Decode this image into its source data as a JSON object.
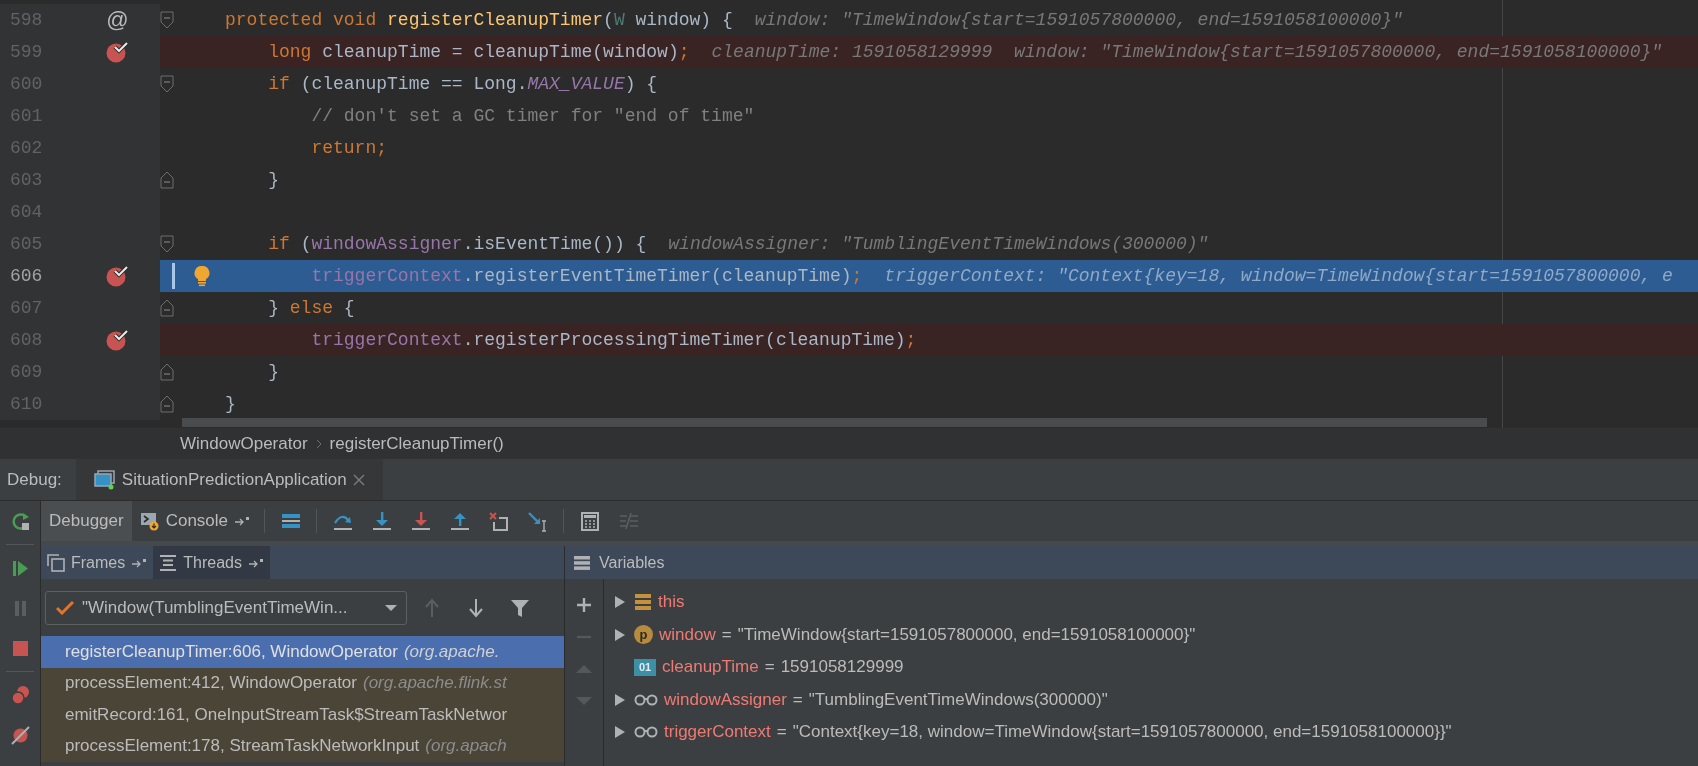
{
  "editor": {
    "lines": [
      {
        "number": "598",
        "gutter_mark": "@",
        "breakpoint": false,
        "current": false,
        "intention": false,
        "fold_start": true,
        "fold_end": false,
        "tokens": [
          {
            "text": "protected void ",
            "kind": "keyword"
          },
          {
            "text": "registerCleanupTimer",
            "kind": "method"
          },
          {
            "text": "(",
            "kind": "plain"
          },
          {
            "text": "W",
            "kind": "type"
          },
          {
            "text": " window) {",
            "kind": "plain"
          }
        ],
        "hint": "window: \"TimeWindow{start=1591057800000, end=1591058100000}\""
      },
      {
        "number": "599",
        "breakpoint": true,
        "current": false,
        "intention": false,
        "fold_start": false,
        "fold_end": false,
        "tokens": [
          {
            "text": "    long ",
            "kind": "keyword"
          },
          {
            "text": "cleanupTime = cleanupTime(window)",
            "kind": "plain"
          },
          {
            "text": ";",
            "kind": "keyword"
          }
        ],
        "hint": "cleanupTime: 1591058129999  window: \"TimeWindow{start=1591057800000, end=1591058100000}\""
      },
      {
        "number": "600",
        "breakpoint": false,
        "current": false,
        "intention": false,
        "fold_start": true,
        "fold_end": false,
        "tokens": [
          {
            "text": "    if ",
            "kind": "keyword"
          },
          {
            "text": "(cleanupTime == Long.",
            "kind": "plain"
          },
          {
            "text": "MAX_VALUE",
            "kind": "constant"
          },
          {
            "text": ") {",
            "kind": "plain"
          }
        ]
      },
      {
        "number": "601",
        "breakpoint": false,
        "current": false,
        "intention": false,
        "fold_start": false,
        "fold_end": false,
        "tokens": [
          {
            "text": "        // don't set a GC timer for \"end of time\"",
            "kind": "comment"
          }
        ]
      },
      {
        "number": "602",
        "breakpoint": false,
        "current": false,
        "intention": false,
        "fold_start": false,
        "fold_end": false,
        "tokens": [
          {
            "text": "        return;",
            "kind": "keyword"
          }
        ]
      },
      {
        "number": "603",
        "breakpoint": false,
        "current": false,
        "intention": false,
        "fold_start": false,
        "fold_end": true,
        "tokens": [
          {
            "text": "    }",
            "kind": "plain"
          }
        ]
      },
      {
        "number": "604",
        "breakpoint": false,
        "current": false,
        "intention": false,
        "fold_start": false,
        "fold_end": false
      },
      {
        "number": "605",
        "breakpoint": false,
        "current": false,
        "intention": false,
        "fold_start": true,
        "fold_end": false,
        "tokens": [
          {
            "text": "    if ",
            "kind": "keyword"
          },
          {
            "text": "(",
            "kind": "plain"
          },
          {
            "text": "windowAssigner",
            "kind": "field"
          },
          {
            "text": ".isEventTime()) {",
            "kind": "plain"
          }
        ],
        "hint": "windowAssigner: \"TumblingEventTimeWindows(300000)\""
      },
      {
        "number": "606",
        "breakpoint": true,
        "current": true,
        "intention": true,
        "fold_start": false,
        "fold_end": false,
        "tokens": [
          {
            "text": "        triggerContext",
            "kind": "field"
          },
          {
            "text": ".registerEventTimeTimer(cleanupTime)",
            "kind": "plain"
          },
          {
            "text": ";",
            "kind": "keyword"
          }
        ],
        "hint": "triggerContext: \"Context{key=18, window=TimeWindow{start=1591057800000, e"
      },
      {
        "number": "607",
        "breakpoint": false,
        "current": false,
        "intention": false,
        "fold_start": false,
        "fold_end": true,
        "tokens": [
          {
            "text": "    } ",
            "kind": "plain"
          },
          {
            "text": "else",
            "kind": "keyword"
          },
          {
            "text": " {",
            "kind": "plain"
          }
        ]
      },
      {
        "number": "608",
        "breakpoint": true,
        "current": false,
        "intention": false,
        "fold_start": false,
        "fold_end": false,
        "tokens": [
          {
            "text": "        triggerContext",
            "kind": "field"
          },
          {
            "text": ".registerProcessingTimeTimer(cleanupTime)",
            "kind": "plain"
          },
          {
            "text": ";",
            "kind": "keyword"
          }
        ]
      },
      {
        "number": "609",
        "breakpoint": false,
        "current": false,
        "intention": false,
        "fold_start": false,
        "fold_end": true,
        "tokens": [
          {
            "text": "    }",
            "kind": "plain"
          }
        ]
      },
      {
        "number": "610",
        "breakpoint": false,
        "current": false,
        "intention": false,
        "fold_start": false,
        "fold_end": true,
        "tokens": [
          {
            "text": "}",
            "kind": "plain"
          }
        ]
      }
    ]
  },
  "breadcrumb": [
    "WindowOperator",
    "registerCleanupTimer()"
  ],
  "debug_bar": {
    "label": "Debug:",
    "tabs": [
      {
        "label": "SituationPredictionApplication",
        "selected": true
      }
    ]
  },
  "side_toolbar": [
    {
      "kind": "rerun",
      "disabled": false
    },
    {
      "kind": "resume",
      "disabled": false
    },
    {
      "kind": "pause",
      "disabled": true
    },
    {
      "kind": "stop",
      "disabled": false
    },
    {
      "kind": "breakpoints",
      "disabled": false
    },
    {
      "kind": "mute",
      "disabled": false
    }
  ],
  "tabs": [
    {
      "label": "Debugger",
      "selected": true
    },
    {
      "label": "Console",
      "selected": false
    }
  ],
  "actions": [
    {
      "kind": "layout",
      "disabled": false
    },
    {
      "kind": "step_over",
      "disabled": false
    },
    {
      "kind": "step_into",
      "disabled": false
    },
    {
      "kind": "force_step_into",
      "disabled": false
    },
    {
      "kind": "step_out",
      "disabled": false
    },
    {
      "kind": "drop_frame",
      "disabled": false
    },
    {
      "kind": "run_to_cursor",
      "disabled": false
    },
    {
      "kind": "evaluate",
      "disabled": false
    },
    {
      "kind": "trace",
      "disabled": true
    }
  ],
  "frames": {
    "tabs": [
      {
        "label": "Frames",
        "selected": true
      },
      {
        "label": "Threads",
        "selected": false
      }
    ],
    "thread": "\"Window(TumblingEventTimeWin...",
    "nav": [
      {
        "kind": "up",
        "disabled": true
      },
      {
        "kind": "down",
        "disabled": false
      },
      {
        "kind": "filter",
        "disabled": false
      }
    ],
    "rows": [
      {
        "method": "registerCleanupTimer:606, WindowOperator",
        "package": "(org.apache.",
        "selected": true
      },
      {
        "method": "processElement:412, WindowOperator",
        "package": "(org.apache.flink.st",
        "selected": false
      },
      {
        "method": "emitRecord:161, OneInputStreamTask$StreamTaskNetwor",
        "selected": false
      },
      {
        "method": "processElement:178, StreamTaskNetworkInput",
        "package": "(org.apach",
        "selected": false
      }
    ]
  },
  "variables": {
    "title": "Variables",
    "tools": [
      {
        "kind": "add",
        "disabled": false
      },
      {
        "kind": "remove",
        "disabled": true
      },
      {
        "kind": "up",
        "disabled": true
      },
      {
        "kind": "down",
        "disabled": true
      }
    ],
    "rows": [
      {
        "kind": "object",
        "name": "this",
        "expandable": true
      },
      {
        "kind": "param",
        "badge": "p",
        "name": "window",
        "equals": "=",
        "value": "\"TimeWindow{start=1591057800000, end=1591058100000}\"",
        "expandable": true
      },
      {
        "kind": "primitive",
        "badge": "01",
        "name": "cleanupTime",
        "equals": "=",
        "value": "1591058129999",
        "expandable": false
      },
      {
        "kind": "watch",
        "name": "windowAssigner",
        "equals": "=",
        "value": "\"TumblingEventTimeWindows(300000)\"",
        "expandable": true
      },
      {
        "kind": "watch",
        "name": "triggerContext",
        "equals": "=",
        "value": "\"Context{key=18, window=TimeWindow{start=1591057800000, end=1591058100000}}\"",
        "expandable": true
      }
    ]
  }
}
